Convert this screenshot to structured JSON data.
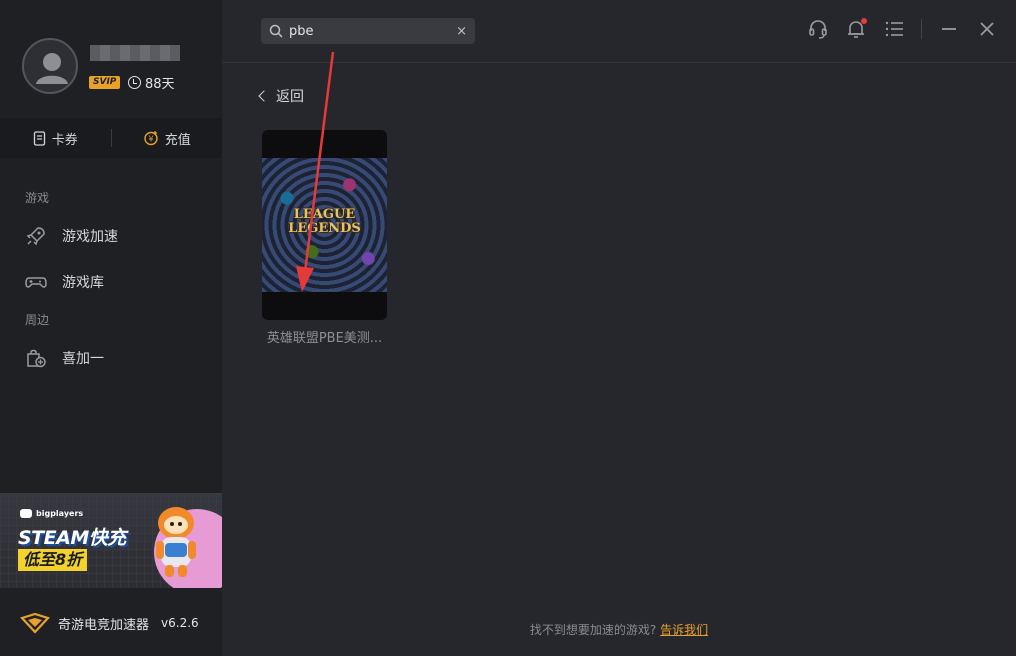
{
  "sidebar": {
    "badge": "SVIP",
    "days": "88天",
    "wallet": {
      "coupon": "卡券",
      "recharge": "充值"
    },
    "sections": {
      "games": "游戏",
      "around": "周边"
    },
    "nav": [
      {
        "label": "游戏加速"
      },
      {
        "label": "游戏库"
      },
      {
        "label": "喜加一"
      }
    ],
    "banner": {
      "brand": "bigplayers",
      "headline": "STEAM快充",
      "promo": "低至8折"
    },
    "app": {
      "name": "奇游电竞加速器",
      "version": "v6.2.6"
    }
  },
  "topbar": {
    "search_value": "pbe",
    "clear": "×"
  },
  "main": {
    "back_label": "返回",
    "results": [
      {
        "title": "英雄联盟PBE美测...",
        "cover_logo": "LEAGUE LEGENDS"
      }
    ],
    "footer_text": "找不到想要加速的游戏?",
    "footer_link": "告诉我们"
  },
  "colors": {
    "accent": "#e8a22c",
    "annotation": "#e53a3a"
  }
}
